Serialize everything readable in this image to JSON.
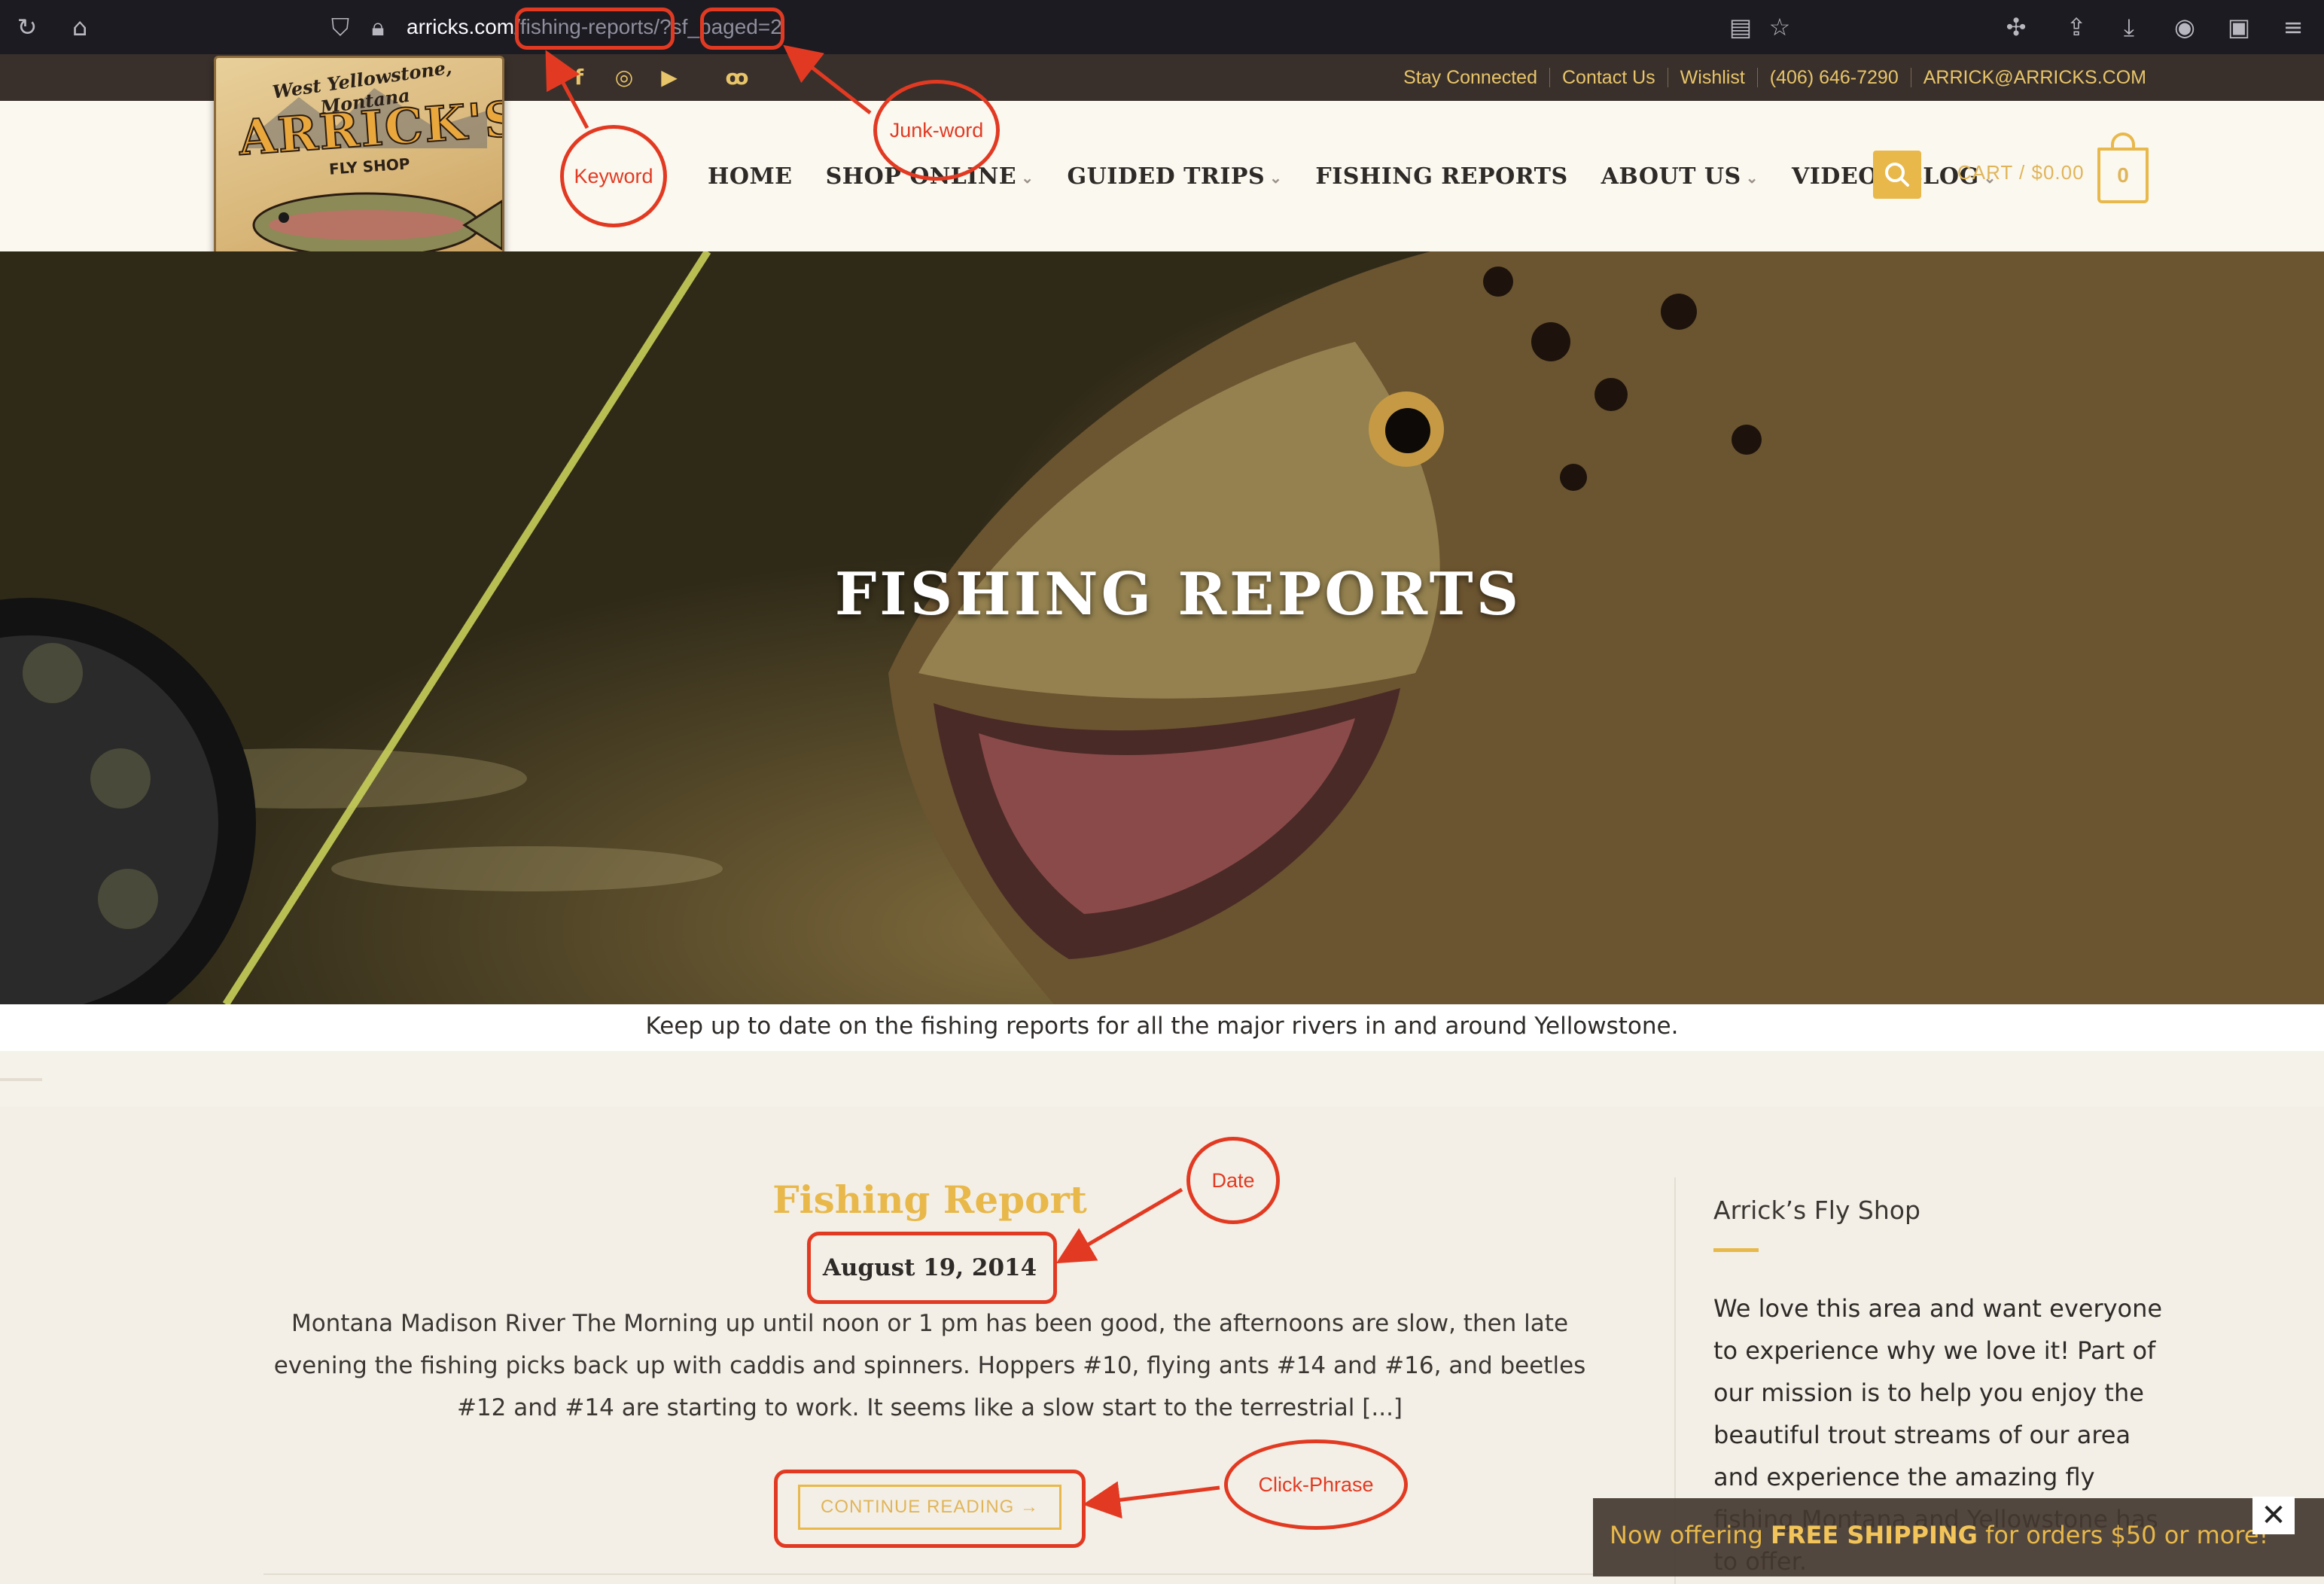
{
  "browser": {
    "url_host": "arricks.com",
    "url_path": "/fishing-reports/?sf_paged=2"
  },
  "topbar": {
    "social_icons": [
      "facebook-icon",
      "instagram-icon",
      "youtube-icon",
      "tripadvisor-icon"
    ],
    "links": [
      "Stay Connected",
      "Contact Us",
      "Wishlist",
      "(406) 646-7290",
      "ARRICK@ARRICKS.COM"
    ]
  },
  "logo": {
    "line1": "West Yellowstone, Montana",
    "name": "ARRICK'S",
    "sub": "FLY SHOP"
  },
  "nav": {
    "items": [
      {
        "label": "HOME",
        "dropdown": false
      },
      {
        "label": "SHOP ONLINE",
        "dropdown": true
      },
      {
        "label": "GUIDED TRIPS",
        "dropdown": true
      },
      {
        "label": "FISHING REPORTS",
        "dropdown": false
      },
      {
        "label": "ABOUT US",
        "dropdown": true
      },
      {
        "label": "VIDEOS/BLOG",
        "dropdown": true
      }
    ],
    "cart_label": "CART / $0.00",
    "cart_count": "0"
  },
  "hero": {
    "title": "FISHING REPORTS",
    "tagline": "Keep up to date on the fishing reports for all the major rivers in and around Yellowstone."
  },
  "post": {
    "title": "Fishing Report",
    "date": "August 19, 2014",
    "excerpt": "Montana Madison River The Morning up until noon or 1 pm has been good, the afternoons are slow, then late evening the fishing picks back up with caddis and spinners. Hoppers #10, flying ants #14 and #16, and beetles #12 and #14 are starting to work. It seems like a slow start to the terrestrial [...]",
    "continue_label": "CONTINUE READING →"
  },
  "sidebar": {
    "title": "Arrick’s Fly Shop",
    "text": "We love this area and want everyone to experience why we love it! Part of our mission is to help you enjoy the beautiful trout streams of our area and experience the amazing fly fishing Montana and Yellowstone has to offer."
  },
  "shipping_banner": {
    "prefix": "Now offering ",
    "highlight": "FREE SHIPPING",
    "suffix": " for orders $50 or more!",
    "close": "✕"
  },
  "annotations": {
    "keyword": "Keyword",
    "junk_word": "Junk-word",
    "date": "Date",
    "click_phrase": "Click-Phrase"
  },
  "colors": {
    "accent": "#e8b84a",
    "annotation": "#e23a22",
    "topbar": "#3a302b"
  }
}
